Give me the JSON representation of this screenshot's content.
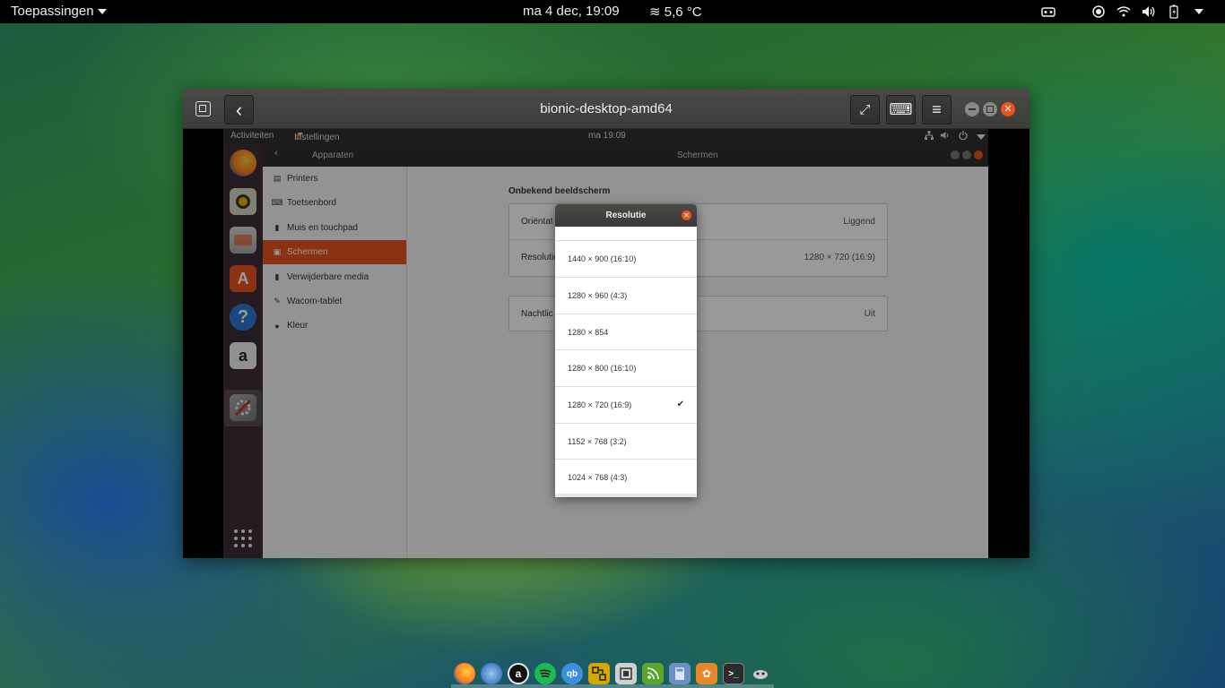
{
  "host": {
    "apps_menu": "Toepassingen",
    "clock": "ma  4 dec, 19:09",
    "weather_icon": "≋",
    "weather": "5,6 °C",
    "tray_icons": [
      "screen-recorder-icon",
      "screenshot-icon",
      "wifi-icon",
      "volume-icon",
      "battery-icon"
    ],
    "dock_icons": [
      "firefox-icon",
      "thunderbird-icon",
      "amazon-icon",
      "spotify-icon",
      "qbittorrent-icon",
      "pattern-icon",
      "virt-manager-icon",
      "rss-icon",
      "calculator-icon",
      "settings-icon",
      "terminal-icon",
      "gnome-icon"
    ]
  },
  "vm_window": {
    "title": "bionic-desktop-amd64",
    "back_label": "‹",
    "fullscreen_label": "⤢",
    "keyboard_label": "⌨",
    "menu_label": "≡"
  },
  "guest": {
    "activities": "Activiteiten",
    "app_menu": "Instellingen",
    "clock": "ma 19:09",
    "section": "Apparaten",
    "title": "Schermen",
    "sidebar": [
      {
        "label": "Printers",
        "icon": "printer-icon"
      },
      {
        "label": "Toetsenbord",
        "icon": "keyboard-icon"
      },
      {
        "label": "Muis en touchpad",
        "icon": "mouse-icon"
      },
      {
        "label": "Schermen",
        "icon": "display-icon",
        "active": true
      },
      {
        "label": "Verwijderbare media",
        "icon": "usb-icon"
      },
      {
        "label": "Wacom-tablet",
        "icon": "tablet-icon"
      },
      {
        "label": "Kleur",
        "icon": "color-icon"
      }
    ],
    "content": {
      "heading": "Onbekend beeldscherm",
      "orientation_label": "Oriëntat",
      "orientation_value": "Liggend",
      "resolution_label": "Resolutie",
      "resolution_value": "1280 × 720 (16:9)",
      "nightlight_label": "Nachtlic",
      "nightlight_value": "Uit"
    },
    "dialog": {
      "title": "Resolutie",
      "options": [
        {
          "label": "1440 × 900 (16:10)",
          "selected": false
        },
        {
          "label": "1280 × 960 (4:3)",
          "selected": false
        },
        {
          "label": "1280 × 854",
          "selected": false
        },
        {
          "label": "1280 × 800 (16:10)",
          "selected": false
        },
        {
          "label": "1280 × 720 (16:9)",
          "selected": true
        },
        {
          "label": "1152 × 768 (3:2)",
          "selected": false
        },
        {
          "label": "1024 × 768 (4:3)",
          "selected": false
        }
      ],
      "check_mark": "✔"
    }
  },
  "colors": {
    "accent": "#e95420",
    "dock_bg": "#3d2e36"
  }
}
